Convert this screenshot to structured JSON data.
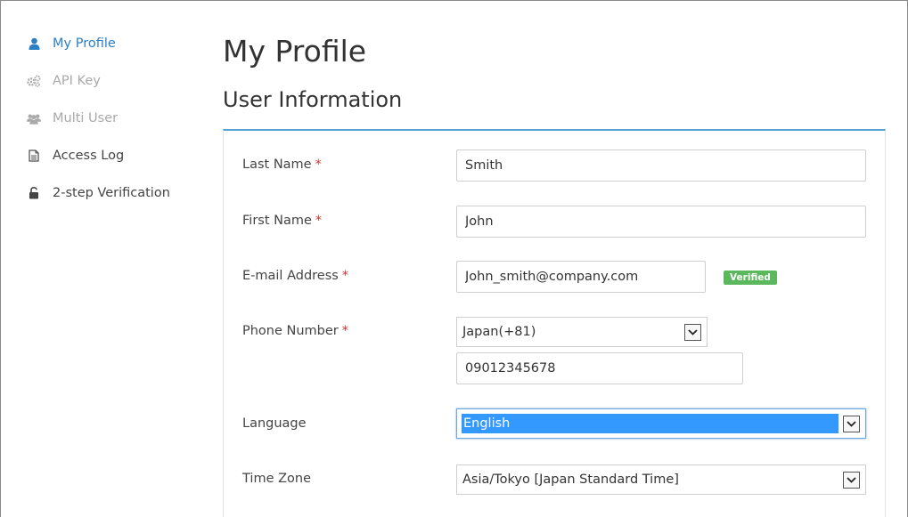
{
  "sidebar": {
    "items": [
      {
        "label": "My Profile",
        "icon": "user-icon",
        "state": "active"
      },
      {
        "label": "API Key",
        "icon": "gears-icon",
        "state": "disabled"
      },
      {
        "label": "Multi User",
        "icon": "users-icon",
        "state": "disabled"
      },
      {
        "label": "Access Log",
        "icon": "document-icon",
        "state": "normal"
      },
      {
        "label": "2-step Verification",
        "icon": "unlock-icon",
        "state": "normal"
      }
    ]
  },
  "main": {
    "page_title": "My Profile",
    "section_title": "User Information"
  },
  "form": {
    "required_mark": "*",
    "last_name": {
      "label": "Last Name",
      "value": "Smith"
    },
    "first_name": {
      "label": "First Name",
      "value": "John"
    },
    "email": {
      "label": "E-mail Address",
      "value": "John_smith@company.com",
      "badge": "Verified"
    },
    "phone": {
      "label": "Phone Number",
      "country": "Japan(+81)",
      "number": "09012345678"
    },
    "language": {
      "label": "Language",
      "value": "English"
    },
    "timezone": {
      "label": "Time Zone",
      "value": "Asia/Tokyo [Japan Standard Time]"
    }
  },
  "colors": {
    "accent": "#2b7fc2",
    "panel_border": "#5aa3d6",
    "required": "#d9302c",
    "verified": "#5cb85c",
    "selection": "#3399ff"
  }
}
